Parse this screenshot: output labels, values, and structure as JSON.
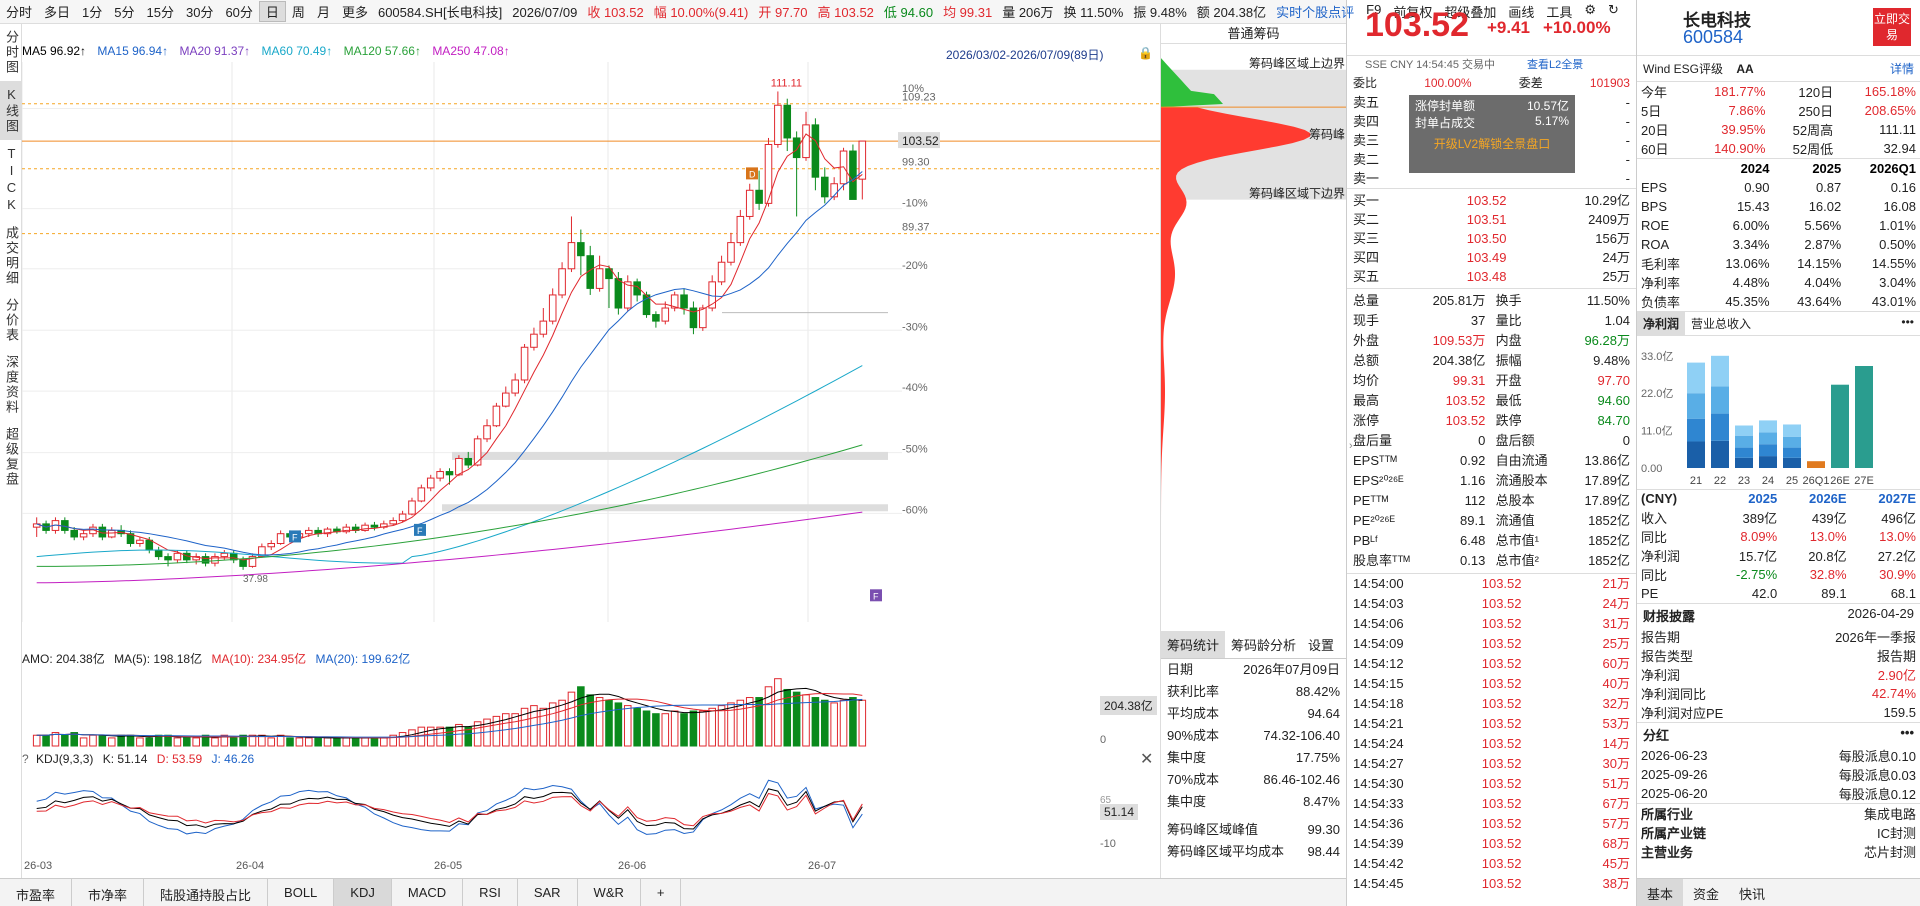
{
  "topbar": {
    "periods": [
      "分时",
      "多日",
      "1分",
      "5分",
      "15分",
      "30分",
      "60分",
      "日",
      "周",
      "月",
      "更多"
    ],
    "selected_period": "日",
    "code": "600584.SH[长电科技]",
    "date": "2026/07/09",
    "close": "收 103.52",
    "change": "幅 10.00%(9.41)",
    "open": "开 97.70",
    "high": "高 103.52",
    "low": "低 94.60",
    "avg": "均 99.31",
    "vol": "量 206万",
    "turnover": "换 11.50%",
    "amp": "振 9.48%",
    "amount": "额 204.38亿",
    "right_items": [
      "实时个股点评",
      "F9",
      "前复权",
      "超级叠加",
      "画线",
      "工具"
    ]
  },
  "leftnav": [
    "分时图",
    "K线图",
    "TICK",
    "成交明细",
    "分价表",
    "深度资料",
    "超级复盘"
  ],
  "ma": {
    "ma5": "MA5 96.92↑",
    "ma15": "MA15 96.94↑",
    "ma20": "MA20 91.37↑",
    "ma60": "MA60 70.49↑",
    "ma120": "MA120 57.66↑",
    "ma250": "MA250 47.08↑",
    "range": "2026/03/02-2026/07/09(89日)"
  },
  "price_labels": {
    "p10": "10%",
    "top": "109.23",
    "cur": "103.52",
    "p1": "99.30",
    "m10": "-10%",
    "p2": "89.37",
    "m20": "-20%",
    "m30": "-30%",
    "m40": "-40%",
    "m50": "-50%",
    "m60": "-60%",
    "high": "111.11",
    "low": "37.98"
  },
  "chip": {
    "title": "普通筹码",
    "up": "筹码峰区域上边界",
    "peak": "筹码峰",
    "down": "筹码峰区域下边界",
    "tabs": [
      "筹码统计",
      "筹码龄分析",
      "设置"
    ],
    "stats": [
      [
        "日期",
        "2026年07月09日"
      ],
      [
        "获利比率",
        "88.42%"
      ],
      [
        "平均成本",
        "94.64"
      ],
      [
        "90%成本",
        "74.32-106.40"
      ],
      [
        "集中度",
        "17.75%"
      ],
      [
        "70%成本",
        "86.46-102.46"
      ],
      [
        "集中度",
        "8.47%"
      ],
      [
        "筹码峰区域峰值",
        "99.30"
      ],
      [
        "筹码峰区域平均成本",
        "98.44"
      ]
    ]
  },
  "amo": {
    "label": "AMO: 204.38亿",
    "ma5": "MA(5): 198.18亿",
    "ma10": "MA(10): 234.95亿",
    "ma20": "MA(20): 199.62亿",
    "cur": "204.38亿",
    "zero": "0"
  },
  "kdj": {
    "label": "KDJ(9,3,3)",
    "k": "K: 51.14",
    "d": "D: 53.59",
    "j": "J: 46.26",
    "cur": "51.14",
    "s65": "65",
    "s10": "-10"
  },
  "xaxis": [
    "26-03",
    "26-04",
    "26-05",
    "26-06",
    "26-07"
  ],
  "bottomtabs": [
    "市盈率",
    "市净率",
    "陆股通持股占比",
    "BOLL",
    "KDJ",
    "MACD",
    "RSI",
    "SAR",
    "W&R",
    "+"
  ],
  "quote": {
    "price": "103.52",
    "chg": "+9.41",
    "pct": "+10.00%",
    "name": "长电科技",
    "code": "600584",
    "trade_btn": "立即交易",
    "sub": "SSE  CNY  14:54:45  交易中",
    "l2": "查看L2全景",
    "webi": "委比",
    "webi_v": "100.00%",
    "weicha": "委差",
    "weicha_v": "101903",
    "limit_up_amt": "涨停封单额",
    "limit_up_amt_v": "10.57亿",
    "seal": "封单占成交",
    "seal_v": "5.17%",
    "l2btn": "开级LV2解锁全景盘口",
    "asks": [
      "卖五",
      "卖四",
      "卖三",
      "卖二",
      "卖一"
    ],
    "bids": [
      [
        "买一",
        "103.52",
        "10.29亿"
      ],
      [
        "买二",
        "103.51",
        "2409万"
      ],
      [
        "买三",
        "103.50",
        "156万"
      ],
      [
        "买四",
        "103.49",
        "24万"
      ],
      [
        "买五",
        "103.48",
        "25万"
      ]
    ],
    "stats": [
      [
        "总量",
        "205.81万",
        "换手",
        "11.50%"
      ],
      [
        "现手",
        "37",
        "量比",
        "1.04"
      ],
      [
        "外盘",
        "109.53万",
        "内盘",
        "96.28万"
      ],
      [
        "总额",
        "204.38亿",
        "振幅",
        "9.48%"
      ],
      [
        "均价",
        "99.31",
        "开盘",
        "97.70"
      ],
      [
        "最高",
        "103.52",
        "最低",
        "94.60"
      ],
      [
        "涨停",
        "103.52",
        "跌停",
        "84.70"
      ],
      [
        "盘后量",
        "0",
        "盘后额",
        "0"
      ],
      [
        "EPSᵀᵀᴹ",
        "0.92",
        "自由流通",
        "13.86亿"
      ],
      [
        "EPS²⁰²⁶ᴱ",
        "1.16",
        "流通股本",
        "17.89亿"
      ],
      [
        "PEᵀᵀᴹ",
        "112",
        "总股本",
        "17.89亿"
      ],
      [
        "PE²⁰²⁶ᴱ",
        "89.1",
        "流通值",
        "1852亿"
      ],
      [
        "PBᴸᶠ",
        "6.48",
        "总市值¹",
        "1852亿"
      ],
      [
        "股息率ᵀᵀᴹ",
        "0.13",
        "总市值²",
        "1852亿"
      ]
    ],
    "ticks": [
      [
        "14:54:00",
        "103.52",
        "21万"
      ],
      [
        "14:54:03",
        "103.52",
        "24万"
      ],
      [
        "14:54:06",
        "103.52",
        "31万"
      ],
      [
        "14:54:09",
        "103.52",
        "25万"
      ],
      [
        "14:54:12",
        "103.52",
        "60万"
      ],
      [
        "14:54:15",
        "103.52",
        "40万"
      ],
      [
        "14:54:18",
        "103.52",
        "32万"
      ],
      [
        "14:54:21",
        "103.52",
        "53万"
      ],
      [
        "14:54:24",
        "103.52",
        "14万"
      ],
      [
        "14:54:27",
        "103.52",
        "30万"
      ],
      [
        "14:54:30",
        "103.52",
        "51万"
      ],
      [
        "14:54:33",
        "103.52",
        "67万"
      ],
      [
        "14:54:36",
        "103.52",
        "57万"
      ],
      [
        "14:54:39",
        "103.52",
        "68万"
      ],
      [
        "14:54:42",
        "103.52",
        "45万"
      ],
      [
        "14:54:45",
        "103.52",
        "38万"
      ]
    ]
  },
  "fund": {
    "esg": "Wind ESG评级",
    "esg_v": "AA",
    "detail": "详情",
    "perf": [
      [
        "今年",
        "181.77%",
        "120日",
        "165.18%"
      ],
      [
        "5日",
        "7.86%",
        "250日",
        "208.65%"
      ],
      [
        "20日",
        "39.95%",
        "52周高",
        "111.11"
      ],
      [
        "60日",
        "140.90%",
        "52周低",
        "32.94"
      ]
    ],
    "hdr": [
      "",
      "2024",
      "2025",
      "2026Q1"
    ],
    "fin": [
      [
        "EPS",
        "0.90",
        "0.87",
        "0.16"
      ],
      [
        "BPS",
        "15.43",
        "16.02",
        "16.08"
      ],
      [
        "ROE",
        "6.00%",
        "5.56%",
        "1.01%"
      ],
      [
        "ROA",
        "3.34%",
        "2.87%",
        "0.50%"
      ],
      [
        "毛利率",
        "13.06%",
        "14.15%",
        "14.55%"
      ],
      [
        "净利率",
        "4.48%",
        "4.04%",
        "3.04%"
      ],
      [
        "负债率",
        "45.35%",
        "43.64%",
        "43.01%"
      ]
    ],
    "tabs": [
      "净利润",
      "营业总收入"
    ],
    "ylabels": [
      "33.0亿",
      "22.0亿",
      "11.0亿",
      "0.00"
    ],
    "xlabels": [
      "21",
      "22",
      "23",
      "24",
      "25",
      "26Q1",
      "26E",
      "27E"
    ],
    "fc_hdr": [
      "(CNY)",
      "2025",
      "2026E",
      "2027E"
    ],
    "fc": [
      [
        "收入",
        "389亿",
        "439亿",
        "496亿"
      ],
      [
        "同比",
        "8.09%",
        "13.0%",
        "13.0%"
      ],
      [
        "净利润",
        "15.7亿",
        "20.8亿",
        "27.2亿"
      ],
      [
        "同比",
        "-2.75%",
        "32.8%",
        "30.9%"
      ],
      [
        "PE",
        "42.0",
        "89.1",
        "68.1"
      ]
    ],
    "disclosure_title": "财报披露",
    "disclosure_date": "2026-04-29",
    "disc": [
      [
        "报告期",
        "2026年一季报"
      ],
      [
        "报告类型",
        "报告期"
      ],
      [
        "净利润",
        "2.90亿"
      ],
      [
        "净利润同比",
        "42.74%"
      ],
      [
        "净利润对应PE",
        "159.5"
      ]
    ],
    "div_title": "分红",
    "divs": [
      [
        "2026-06-23",
        "每股派息0.10"
      ],
      [
        "2025-09-26",
        "每股派息0.03"
      ],
      [
        "2025-06-20",
        "每股派息0.12"
      ]
    ],
    "ind": [
      [
        "所属行业",
        "集成电路"
      ],
      [
        "所属产业链",
        "IC封测"
      ],
      [
        "主营业务",
        "芯片封测"
      ]
    ],
    "btabs": [
      "基本",
      "资金",
      "快讯"
    ]
  },
  "chart_data": {
    "type": "candlestick",
    "title": "600584.SH[长电科技]",
    "ylim": [
      37.98,
      111.11
    ],
    "candles": [
      [
        44.5,
        45,
        43,
        46
      ],
      [
        45,
        44,
        43.5,
        45.5
      ],
      [
        44,
        45.5,
        43.5,
        46
      ],
      [
        45.5,
        44,
        43.5,
        46
      ],
      [
        44,
        43,
        42.5,
        44.5
      ],
      [
        43,
        43.5,
        42.5,
        44
      ],
      [
        43.5,
        44.5,
        43,
        45
      ],
      [
        44.5,
        43,
        42.5,
        45
      ],
      [
        43,
        44,
        42.8,
        44.5
      ],
      [
        44,
        43.5,
        43,
        44.8
      ],
      [
        43.5,
        42,
        41.5,
        44
      ],
      [
        42,
        42.5,
        41.5,
        43
      ],
      [
        42.5,
        41,
        40.5,
        43
      ],
      [
        41,
        40,
        39.5,
        41.5
      ],
      [
        40,
        39.5,
        38.5,
        40.5
      ],
      [
        39.5,
        40.5,
        39,
        41
      ],
      [
        40.5,
        39.5,
        39,
        41
      ],
      [
        39.5,
        40,
        38.8,
        40.5
      ],
      [
        40,
        39,
        38.5,
        40.5
      ],
      [
        39,
        40,
        38.5,
        40.5
      ],
      [
        40,
        40.5,
        39.5,
        41
      ],
      [
        40.5,
        39.5,
        39,
        41
      ],
      [
        39.5,
        38.5,
        37.98,
        40
      ],
      [
        38.5,
        40,
        38.3,
        40.5
      ],
      [
        40,
        41.5,
        39.8,
        42
      ],
      [
        41.5,
        42,
        41,
        42.5
      ],
      [
        42,
        43.5,
        41.8,
        44
      ],
      [
        43.5,
        43,
        42.5,
        44
      ],
      [
        43,
        43.5,
        42.5,
        44
      ],
      [
        43.5,
        44,
        43,
        44.5
      ],
      [
        44,
        43.5,
        43,
        44.5
      ],
      [
        43.5,
        44.2,
        43,
        44.5
      ],
      [
        44.2,
        43.8,
        43.5,
        44.6
      ],
      [
        43.8,
        44.5,
        43.5,
        45
      ],
      [
        44.5,
        44,
        43.6,
        45
      ],
      [
        44,
        44.8,
        43.8,
        45.2
      ],
      [
        44.8,
        44.5,
        44,
        45.3
      ],
      [
        44.5,
        45,
        44.2,
        45.5
      ],
      [
        45,
        45.5,
        44.8,
        46
      ],
      [
        45.5,
        46.5,
        45.2,
        47
      ],
      [
        46.5,
        48.5,
        46.3,
        49
      ],
      [
        48.5,
        50.5,
        48.3,
        51
      ],
      [
        50.5,
        52,
        50,
        52.5
      ],
      [
        52,
        53,
        51.5,
        53.5
      ],
      [
        53,
        52.5,
        51,
        53.5
      ],
      [
        52.5,
        55,
        52.3,
        55.5
      ],
      [
        55,
        54,
        53.5,
        56
      ],
      [
        54,
        58,
        53.8,
        58.5
      ],
      [
        58,
        60,
        57.5,
        61
      ],
      [
        60,
        63,
        59.8,
        63.5
      ],
      [
        63,
        65,
        62.8,
        66
      ],
      [
        65,
        67,
        64.5,
        68
      ],
      [
        67,
        72,
        66.5,
        72.5
      ],
      [
        72,
        74,
        71.5,
        75
      ],
      [
        74,
        76,
        73.5,
        78
      ],
      [
        76,
        80,
        75.5,
        81
      ],
      [
        80,
        84,
        79.5,
        85
      ],
      [
        84,
        88,
        83.5,
        92
      ],
      [
        88,
        86,
        83,
        90
      ],
      [
        86,
        81,
        80,
        87.5
      ],
      [
        81,
        84,
        80.5,
        86
      ],
      [
        84,
        82.5,
        78,
        84.5
      ],
      [
        82.5,
        78,
        77,
        83.5
      ],
      [
        78,
        82,
        77.5,
        83
      ],
      [
        82,
        80,
        79,
        82.5
      ],
      [
        80,
        77,
        76.5,
        80.5
      ],
      [
        77,
        76,
        75,
        77.5
      ],
      [
        76,
        78,
        75.5,
        79
      ],
      [
        78,
        80,
        77.5,
        80.5
      ],
      [
        80,
        78,
        77,
        81
      ],
      [
        78,
        75,
        74,
        79
      ],
      [
        75,
        78,
        74.5,
        78.5
      ],
      [
        78,
        82,
        77.5,
        83
      ],
      [
        82,
        85,
        81.5,
        86
      ],
      [
        85,
        88,
        84.5,
        89.5
      ],
      [
        88,
        92,
        87.5,
        93
      ],
      [
        92,
        96,
        91.5,
        97
      ],
      [
        96,
        94,
        93,
        99
      ],
      [
        94,
        103,
        93.5,
        104
      ],
      [
        103,
        109,
        102.5,
        111.11
      ],
      [
        109,
        104,
        102,
        110
      ],
      [
        104,
        101,
        92,
        105
      ],
      [
        101,
        106,
        100.5,
        108
      ],
      [
        106,
        98,
        96,
        107
      ],
      [
        98,
        95,
        94,
        99.5
      ],
      [
        95,
        97,
        94.5,
        98
      ],
      [
        97,
        102,
        96,
        102.5
      ],
      [
        102,
        94.6,
        94.6,
        103
      ],
      [
        97.7,
        103.52,
        94.6,
        103.52
      ]
    ]
  }
}
